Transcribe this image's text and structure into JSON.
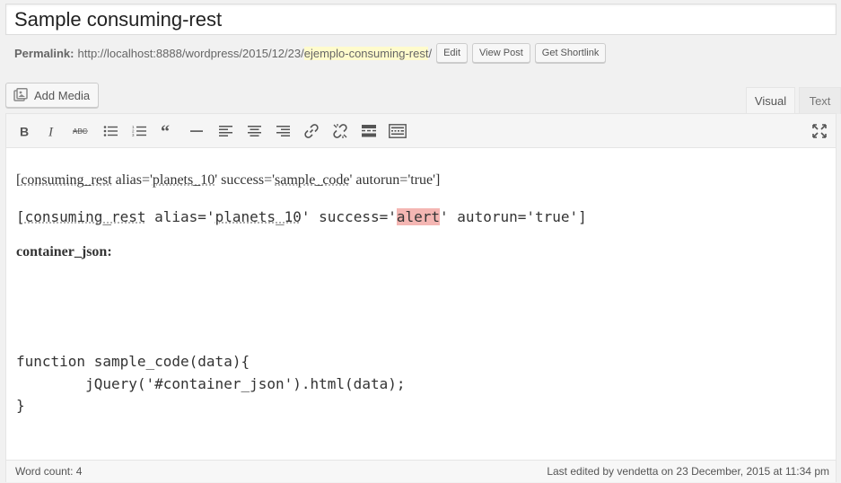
{
  "post": {
    "title": "Sample consuming-rest"
  },
  "permalink": {
    "label": "Permalink:",
    "base_url": "http://localhost:8888/wordpress/2015/12/23/",
    "slug": "ejemplo-consuming-rest",
    "trailing": "/",
    "edit_label": "Edit",
    "view_post_label": "View Post",
    "shortlink_label": "Get Shortlink"
  },
  "media": {
    "add_media_label": "Add Media"
  },
  "tabs": {
    "visual": "Visual",
    "text": "Text",
    "active": "Visual"
  },
  "toolbar": {
    "buttons": [
      "bold-icon",
      "italic-icon",
      "strikethrough-icon",
      "bulleted-list-icon",
      "numbered-list-icon",
      "blockquote-icon",
      "horizontal-line-icon",
      "align-left-icon",
      "align-center-icon",
      "align-right-icon",
      "insert-link-icon",
      "remove-link-icon",
      "read-more-icon",
      "toolbar-toggle-icon",
      "fullscreen-icon"
    ]
  },
  "content": {
    "line1": {
      "p1": "[",
      "p2": "consuming_rest",
      "p3": " alias='",
      "p4": "planets_10",
      "p5": "' success='",
      "p6": "sample_code",
      "p7": "' autorun='true']"
    },
    "line2": {
      "p1": "[",
      "p2": "consuming_rest",
      "p3": " alias='",
      "p4": "planets_10",
      "p5": "' success='",
      "p6": "alert",
      "p7": "' autorun='true']"
    },
    "line3": "container_json:",
    "code": {
      "l1": "function sample_code(data){",
      "l2": "        jQuery('#container_json').html(data);",
      "l3": "}"
    }
  },
  "status": {
    "word_count": "Word count: 4",
    "last_edited": "Last edited by vendetta on 23 December, 2015 at 11:34 pm"
  },
  "colors": {
    "highlight": "#f4b6b3",
    "slug_highlight": "#fffbcc"
  }
}
